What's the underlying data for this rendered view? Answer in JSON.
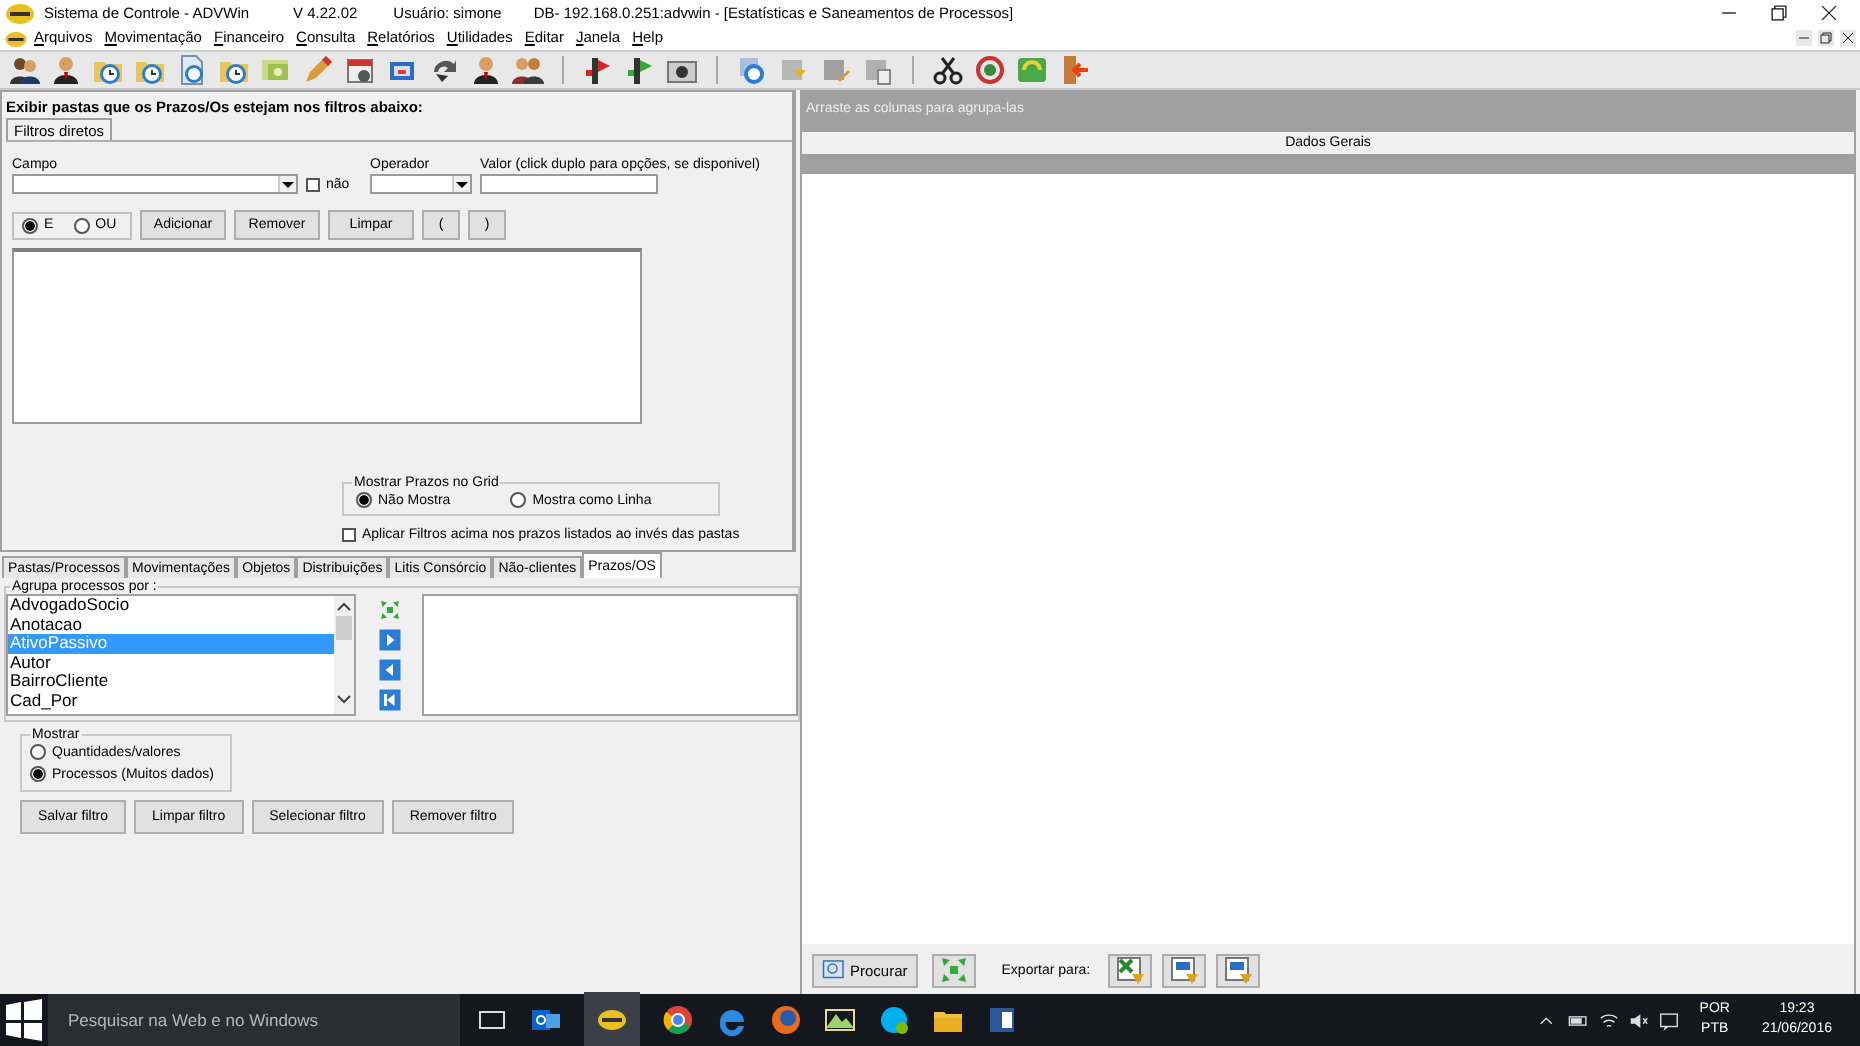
{
  "window": {
    "title": "Sistema de Controle - ADVWin",
    "version": "V 4.22.02",
    "user": "Usuário: simone",
    "database": "DB- 192.168.0.251:advwin - [Estatísticas e Saneamentos de Processos]"
  },
  "menu": [
    "Arquivos",
    "Movimentação",
    "Financeiro",
    "Consulta",
    "Relatórios",
    "Utilidades",
    "Editar",
    "Janela",
    "Help"
  ],
  "filter_panel": {
    "heading": "Exibir pastas que os Prazos/Os estejam nos filtros abaixo:",
    "tabs": [
      {
        "label": "Filtros diretos",
        "selected": true
      }
    ],
    "field_label": "Campo",
    "negate": {
      "label": "não",
      "checked": false
    },
    "operator_label": "Operador",
    "value_label": "Valor (click duplo para opções, se disponivel)",
    "logic": [
      {
        "label": "E",
        "selected": true
      },
      {
        "label": "OU",
        "selected": false
      }
    ],
    "buttons": [
      "Adicionar",
      "Remover",
      "Limpar",
      "(",
      ")"
    ],
    "grid_option": {
      "title": "Mostrar Prazos no Grid",
      "options": [
        {
          "label": "Não Mostra",
          "selected": true
        },
        {
          "label": "Mostra como Linha",
          "selected": false
        }
      ]
    },
    "apply_to_deadlines": {
      "label": "Aplicar Filtros acima nos prazos listados ao invés das pastas",
      "checked": false
    }
  },
  "tabs": [
    {
      "label": "Pastas/Processos",
      "selected": false
    },
    {
      "label": "Movimentações",
      "selected": false
    },
    {
      "label": "Objetos",
      "selected": false
    },
    {
      "label": "Distribuições",
      "selected": false
    },
    {
      "label": "Litis Consórcio",
      "selected": false
    },
    {
      "label": "Não-clientes",
      "selected": false
    },
    {
      "label": "Prazos/OS",
      "selected": true
    }
  ],
  "grouping": {
    "title": "Agrupa processos por :",
    "fields": [
      {
        "label": "AdvogadoSocio",
        "selected": false
      },
      {
        "label": "Anotacao",
        "selected": false
      },
      {
        "label": "AtivoPassivo",
        "selected": true
      },
      {
        "label": "Autor",
        "selected": false
      },
      {
        "label": "BairroCliente",
        "selected": false
      },
      {
        "label": "Cad_Por",
        "selected": false
      }
    ]
  },
  "show": {
    "title": "Mostrar",
    "options": [
      {
        "label": "Quantidades/valores",
        "selected": false
      },
      {
        "label": "Processos (Muitos dados)",
        "selected": true
      }
    ]
  },
  "filter_buttons": [
    "Salvar filtro",
    "Limpar filtro",
    "Selecionar filtro",
    "Remover filtro"
  ],
  "grid": {
    "group_hint": "Arraste as colunas para agrupa-las",
    "band": "Dados Gerais",
    "search_button": "Procurar",
    "export_label": "Exportar para:"
  },
  "taskbar": {
    "search_placeholder": "Pesquisar na Web e no Windows",
    "language": "POR",
    "layout": "PTB",
    "time": "19:23",
    "date": "21/06/2016"
  }
}
